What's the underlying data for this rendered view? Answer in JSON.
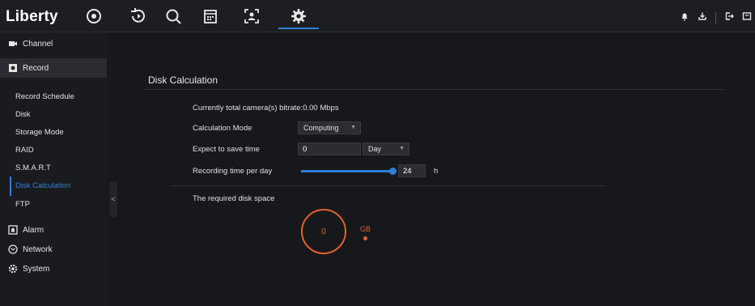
{
  "app": {
    "brand": "Liberty"
  },
  "topnav": {
    "icons": [
      "live-view-icon",
      "playback-icon",
      "search-icon",
      "calendar-icon",
      "face-recognition-icon",
      "settings-gear-icon"
    ],
    "active": "settings-gear-icon",
    "right_icons": [
      "alarm-bell-icon",
      "download-icon",
      "logout-icon",
      "fullscreen-icon"
    ]
  },
  "sidebar": {
    "sections": {
      "channel": "Channel",
      "record": "Record",
      "alarm": "Alarm",
      "network": "Network",
      "system": "System"
    },
    "record_items": {
      "schedule": "Record Schedule",
      "disk": "Disk",
      "storage": "Storage Mode",
      "raid": "RAID",
      "smart": "S.M.A.R.T",
      "calc": "Disk Calculation",
      "ftp": "FTP"
    },
    "collapse_glyph": "<"
  },
  "main": {
    "title": "Disk Calculation",
    "bitrate_text": "Currently total camera(s) bitrate:0.00 Mbps",
    "calc_mode_label": "Calculation Mode",
    "calc_mode_value": "Computing",
    "expect_label": "Expect to save time",
    "expect_value": "0",
    "expect_unit": "Day",
    "recording_label": "Recording time per day",
    "recording_value": "24",
    "recording_unit": "h",
    "recording_fraction": 1.0,
    "required_label": "The required disk space",
    "required_value": "0",
    "required_unit": "GB"
  },
  "colors": {
    "accent": "#2f7fd8",
    "result": "#e2622c",
    "background": "#17181c"
  }
}
